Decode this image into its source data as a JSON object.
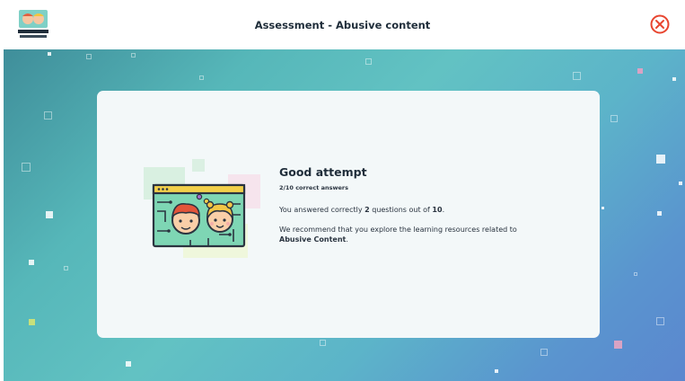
{
  "header": {
    "title": "Assessment - Abusive content",
    "logo_icon": "super-cyber-kids-logo",
    "close_icon": "close-circle-icon",
    "close_color": "#e8452f"
  },
  "result": {
    "title": "Good attempt",
    "score_text": "2/10 correct answers",
    "answered_prefix": "You answered correctly",
    "correct_count": "2",
    "answered_middle": "questions out of",
    "total_count": "10",
    "answered_suffix": ".",
    "recommend_prefix": "We recommend that you explore the learning resources related to",
    "recommend_topic": "Abusive Content",
    "recommend_suffix": ".",
    "illustration_icon": "kids-on-screen-illustration"
  },
  "colors": {
    "background_start": "#3f8e9a",
    "background_end": "#5b87cf",
    "card": "#f3f8f9",
    "text": "#1f2d3a"
  }
}
